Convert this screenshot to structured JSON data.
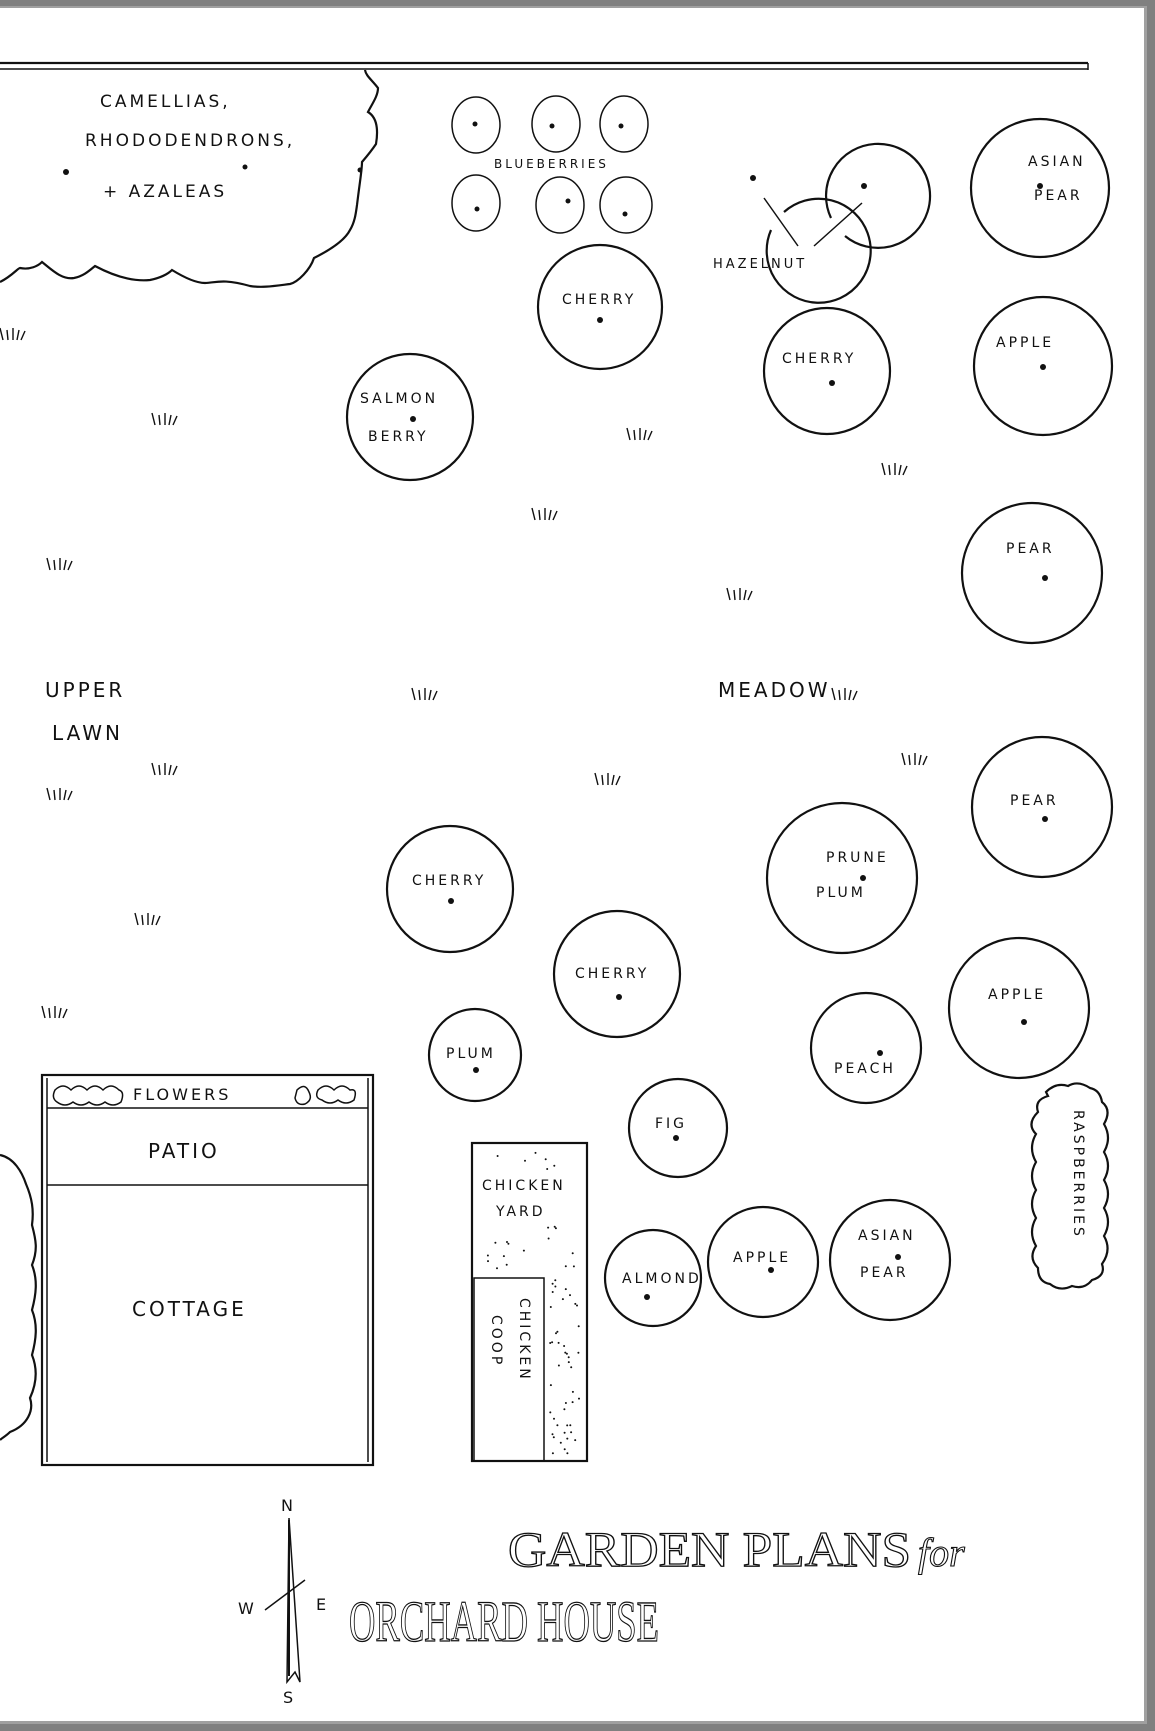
{
  "title": {
    "line1": "GARDEN PLANS",
    "line1_for": "for",
    "line2": "ORCHARD HOUSE"
  },
  "compass": {
    "north": "N",
    "south": "S",
    "east": "E",
    "west": "W"
  },
  "areas": {
    "shrub_bed": [
      "CAMELLIAS,",
      "RHODODENDRONS,",
      "+ AZALEAS"
    ],
    "blueberries": "BLUEBERRIES",
    "hazelnut": "HAZELNUT",
    "upper_lawn": [
      "UPPER",
      "LAWN"
    ],
    "meadow": "MEADOW",
    "flowers": "FLOWERS",
    "patio": "PATIO",
    "cottage": "COTTAGE",
    "chicken_yard": [
      "CHICKEN",
      "YARD"
    ],
    "chicken_coop": [
      "CHICKEN",
      "COOP"
    ],
    "raspberries": "RASPBERRIES"
  },
  "trees": [
    {
      "id": "asian-pear-1",
      "label": [
        "ASIAN",
        "PEAR"
      ]
    },
    {
      "id": "cherry-1",
      "label": [
        "CHERRY"
      ]
    },
    {
      "id": "cherry-2",
      "label": [
        "CHERRY"
      ]
    },
    {
      "id": "apple-1",
      "label": [
        "APPLE"
      ]
    },
    {
      "id": "salmonberry",
      "label": [
        "SALMON",
        "BERRY"
      ]
    },
    {
      "id": "pear-1",
      "label": [
        "PEAR"
      ]
    },
    {
      "id": "pear-2",
      "label": [
        "PEAR"
      ]
    },
    {
      "id": "prune-plum",
      "label": [
        "PRUNE",
        "PLUM"
      ]
    },
    {
      "id": "cherry-3",
      "label": [
        "CHERRY"
      ]
    },
    {
      "id": "cherry-4",
      "label": [
        "CHERRY"
      ]
    },
    {
      "id": "apple-2",
      "label": [
        "APPLE"
      ]
    },
    {
      "id": "plum",
      "label": [
        "PLUM"
      ]
    },
    {
      "id": "peach",
      "label": [
        "PEACH"
      ]
    },
    {
      "id": "fig",
      "label": [
        "FIG"
      ]
    },
    {
      "id": "almond",
      "label": [
        "ALMOND"
      ]
    },
    {
      "id": "apple-3",
      "label": [
        "APPLE"
      ]
    },
    {
      "id": "asian-pear-2",
      "label": [
        "ASIAN",
        "PEAR"
      ]
    }
  ]
}
